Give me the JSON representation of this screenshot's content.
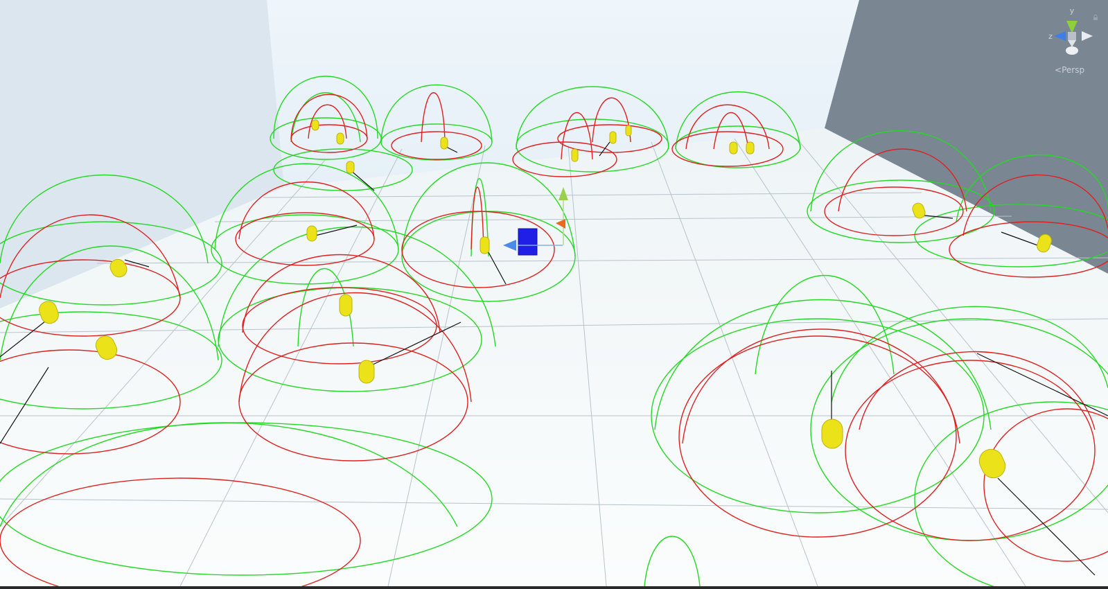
{
  "view": {
    "projection_label": "Persp",
    "gizmo_axis_labels": {
      "y": "y",
      "z": "z"
    },
    "colors": {
      "sky_top": "#e9f3fa",
      "sky_bottom": "#cfe1ee",
      "left_wall": "#dfe8ef",
      "right_wall": "#7c8794",
      "floor": "#f7fbfc",
      "grid": "#b9c6cc",
      "fov_outer": "#1fdc1f",
      "fov_inner": "#e02020",
      "agent": "#ece21a",
      "target": "#1f1fe8",
      "move_tool_blue": "#4d8ae8",
      "move_tool_green": "#9ad14a",
      "move_tool_orange": "#e86b1f"
    },
    "icons": [
      "orientation-gizmo-icon",
      "lock-icon",
      "persp-arrow-icon",
      "move-tool-icon"
    ]
  }
}
